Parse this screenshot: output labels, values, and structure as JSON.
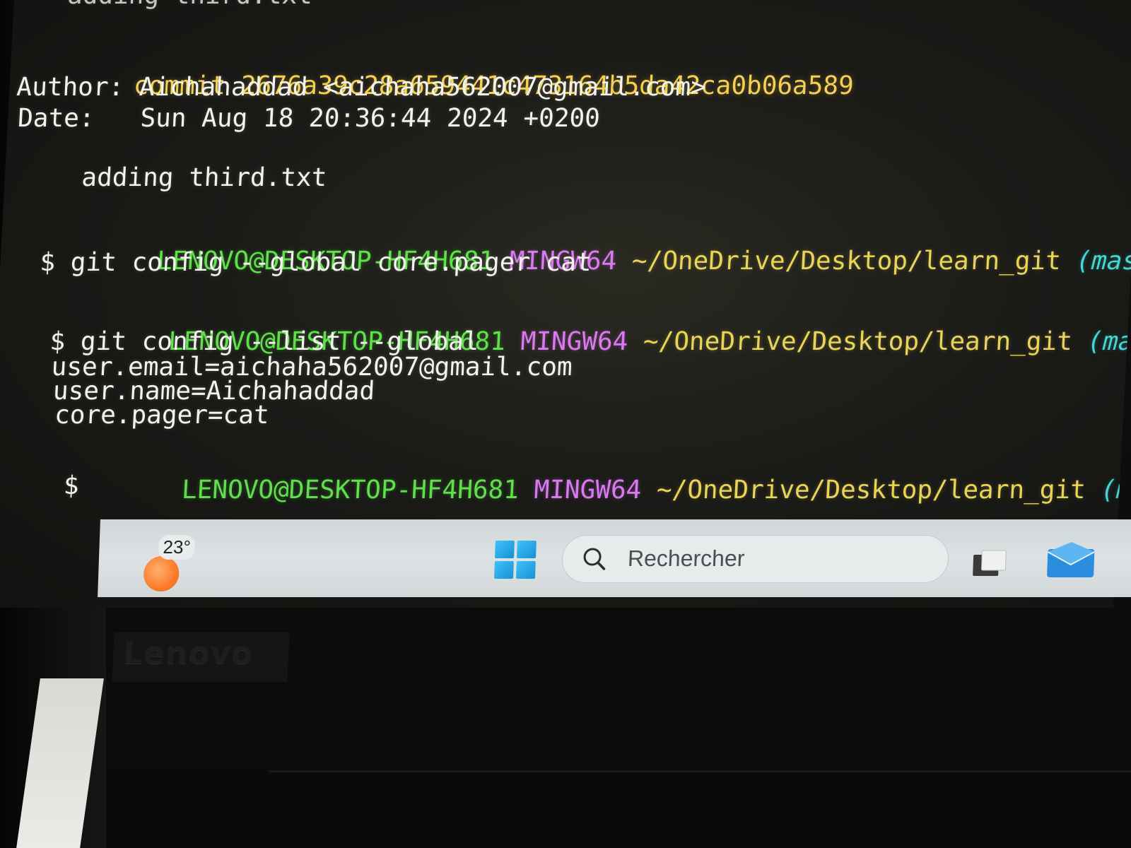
{
  "terminal": {
    "lines": {
      "partial_top": "adding third.txt",
      "commit_label": "commit",
      "commit_hash": "2676a39c28a659441c473164b5da42ca0b06a589",
      "author": "Author: Aichahaddad <aichaha562007@gmail.com>",
      "date": "Date:   Sun Aug 18 20:36:44 2024 +0200",
      "message": "    adding third.txt",
      "prompt1_user": "LENOVO@DESKTOP-HF4H681",
      "prompt1_shell": "MINGW64",
      "prompt1_path": "~/OneDrive/Desktop/learn_git",
      "prompt1_branch": "(master)",
      "cmd1": "$ git config --global core.pager cat",
      "prompt2_user": "LENOVO@DESKTOP-HF4H681",
      "prompt2_shell": "MINGW64",
      "prompt2_path": "~/OneDrive/Desktop/learn_git",
      "prompt2_branch": "(master)",
      "cmd2": "$ git config --list --global",
      "out1": "user.email=aichaha562007@gmail.com",
      "out2": "user.name=Aichahaddad",
      "out3": "core.pager=cat",
      "prompt3_user": "LENOVO@DESKTOP-HF4H681",
      "prompt3_shell": "MINGW64",
      "prompt3_path": "~/OneDrive/Desktop/learn_git",
      "prompt3_branch": "(master)",
      "cursor_prompt": "$"
    }
  },
  "taskbar": {
    "weather_temp": "23°",
    "search_placeholder": "Rechercher",
    "icons": [
      "weather-icon",
      "windows-start-icon",
      "search-icon",
      "file-explorer-icon",
      "mail-icon"
    ]
  },
  "device": {
    "brand_logo": "Lenovo"
  },
  "colors": {
    "commit": "#f2d24a",
    "user_host": "#5fe04a",
    "shell": "#d978f0",
    "path": "#e8d652",
    "branch": "#3fd8d2",
    "text": "#f3f3ee",
    "taskbar": "#d8dedf"
  }
}
